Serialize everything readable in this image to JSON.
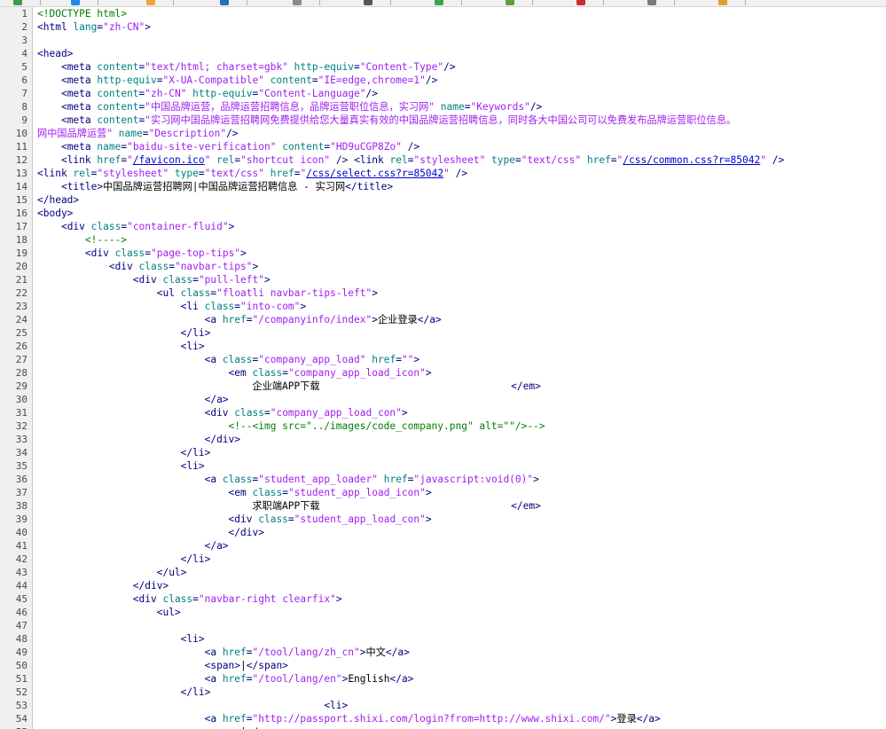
{
  "app": {
    "toolbar_icon_colors": [
      "#3b9c4a",
      "#1e88e5",
      "#f2a23b",
      "#2b6fb5",
      "#8a8a8a",
      "#555555",
      "#3aa655",
      "#5d9e38",
      "#c9302c",
      "#7a7a7a",
      "#e0a030"
    ]
  },
  "colors": {
    "tag": "#000080",
    "attribute": "#008080",
    "value": "#a020f0",
    "comment": "#008000",
    "link": "#0000cc",
    "gutter": "#f0f0f0"
  },
  "editor": {
    "lines": [
      [
        [
          "cmt",
          "<!DOCTYPE html>"
        ]
      ],
      [
        [
          "tag",
          "<html "
        ],
        [
          "att",
          "lang"
        ],
        [
          "tag",
          "="
        ],
        [
          "val",
          "\"zh-CN\""
        ],
        [
          "tag",
          ">"
        ]
      ],
      [],
      [
        [
          "tag",
          "<head>"
        ]
      ],
      [
        [
          "txt",
          "    "
        ],
        [
          "tag",
          "<meta "
        ],
        [
          "att",
          "content"
        ],
        [
          "tag",
          "="
        ],
        [
          "val",
          "\"text/html; charset=gbk\" "
        ],
        [
          "att",
          "http-equiv"
        ],
        [
          "tag",
          "="
        ],
        [
          "val",
          "\"Content-Type\""
        ],
        [
          "tag",
          "/>"
        ]
      ],
      [
        [
          "txt",
          "    "
        ],
        [
          "tag",
          "<meta "
        ],
        [
          "att",
          "http-equiv"
        ],
        [
          "tag",
          "="
        ],
        [
          "val",
          "\"X-UA-Compatible\" "
        ],
        [
          "att",
          "content"
        ],
        [
          "tag",
          "="
        ],
        [
          "val",
          "\"IE=edge,chrome=1\""
        ],
        [
          "tag",
          "/>"
        ]
      ],
      [
        [
          "txt",
          "    "
        ],
        [
          "tag",
          "<meta "
        ],
        [
          "att",
          "content"
        ],
        [
          "tag",
          "="
        ],
        [
          "val",
          "\"zh-CN\" "
        ],
        [
          "att",
          "http-equiv"
        ],
        [
          "tag",
          "="
        ],
        [
          "val",
          "\"Content-Language\""
        ],
        [
          "tag",
          "/>"
        ]
      ],
      [
        [
          "txt",
          "    "
        ],
        [
          "tag",
          "<meta "
        ],
        [
          "att",
          "content"
        ],
        [
          "tag",
          "="
        ],
        [
          "val",
          "\"中国品牌运营，品牌运营招聘信息，品牌运营职位信息，实习网\" "
        ],
        [
          "att",
          "name"
        ],
        [
          "tag",
          "="
        ],
        [
          "val",
          "\"Keywords\""
        ],
        [
          "tag",
          "/>"
        ]
      ],
      [
        [
          "txt",
          "    "
        ],
        [
          "tag",
          "<meta "
        ],
        [
          "att",
          "content"
        ],
        [
          "tag",
          "="
        ],
        [
          "val",
          "\"实习网中国品牌运营招聘网免费提供给您大量真实有效的中国品牌运营招聘信息，同时各大中国公司可以免费发布品牌运营职位信息。"
        ]
      ],
      [
        [
          "val",
          "网中国品牌运营\" "
        ],
        [
          "att",
          "name"
        ],
        [
          "tag",
          "="
        ],
        [
          "val",
          "\"Description\""
        ],
        [
          "tag",
          "/>"
        ]
      ],
      [
        [
          "txt",
          "    "
        ],
        [
          "tag",
          "<meta "
        ],
        [
          "att",
          "name"
        ],
        [
          "tag",
          "="
        ],
        [
          "val",
          "\"baidu-site-verification\" "
        ],
        [
          "att",
          "content"
        ],
        [
          "tag",
          "="
        ],
        [
          "val",
          "\"HD9uCGP8Zo\" "
        ],
        [
          "tag",
          "/>"
        ]
      ],
      [
        [
          "txt",
          "    "
        ],
        [
          "tag",
          "<link "
        ],
        [
          "att",
          "href"
        ],
        [
          "tag",
          "="
        ],
        [
          "val",
          "\""
        ],
        [
          "link",
          "/favicon.ico"
        ],
        [
          "val",
          "\" "
        ],
        [
          "att",
          "rel"
        ],
        [
          "tag",
          "="
        ],
        [
          "val",
          "\"shortcut icon\" "
        ],
        [
          "tag",
          "/> <link "
        ],
        [
          "att",
          "rel"
        ],
        [
          "tag",
          "="
        ],
        [
          "val",
          "\"stylesheet\" "
        ],
        [
          "att",
          "type"
        ],
        [
          "tag",
          "="
        ],
        [
          "val",
          "\"text/css\" "
        ],
        [
          "att",
          "href"
        ],
        [
          "tag",
          "="
        ],
        [
          "val",
          "\""
        ],
        [
          "link",
          "/css/common.css?r=85042"
        ],
        [
          "val",
          "\" "
        ],
        [
          "tag",
          "/>"
        ]
      ],
      [
        [
          "tag",
          "<link "
        ],
        [
          "att",
          "rel"
        ],
        [
          "tag",
          "="
        ],
        [
          "val",
          "\"stylesheet\" "
        ],
        [
          "att",
          "type"
        ],
        [
          "tag",
          "="
        ],
        [
          "val",
          "\"text/css\" "
        ],
        [
          "att",
          "href"
        ],
        [
          "tag",
          "="
        ],
        [
          "val",
          "\""
        ],
        [
          "link",
          "/css/select.css?r=85042"
        ],
        [
          "val",
          "\" "
        ],
        [
          "tag",
          "/>"
        ]
      ],
      [
        [
          "txt",
          "    "
        ],
        [
          "tag",
          "<title>"
        ],
        [
          "txt",
          "中国品牌运营招聘网|中国品牌运营招聘信息 - 实习网"
        ],
        [
          "tag",
          "</title>"
        ]
      ],
      [
        [
          "tag",
          "</head>"
        ]
      ],
      [
        [
          "tag",
          "<body>"
        ]
      ],
      [
        [
          "txt",
          "    "
        ],
        [
          "tag",
          "<div "
        ],
        [
          "att",
          "class"
        ],
        [
          "tag",
          "="
        ],
        [
          "val",
          "\"container-fluid\""
        ],
        [
          "tag",
          ">"
        ]
      ],
      [
        [
          "txt",
          "        "
        ],
        [
          "cmt",
          "<!---->"
        ]
      ],
      [
        [
          "txt",
          "        "
        ],
        [
          "tag",
          "<div "
        ],
        [
          "att",
          "class"
        ],
        [
          "tag",
          "="
        ],
        [
          "val",
          "\"page-top-tips\""
        ],
        [
          "tag",
          ">"
        ]
      ],
      [
        [
          "txt",
          "            "
        ],
        [
          "tag",
          "<div "
        ],
        [
          "att",
          "class"
        ],
        [
          "tag",
          "="
        ],
        [
          "val",
          "\"navbar-tips\""
        ],
        [
          "tag",
          ">"
        ]
      ],
      [
        [
          "txt",
          "                "
        ],
        [
          "tag",
          "<div "
        ],
        [
          "att",
          "class"
        ],
        [
          "tag",
          "="
        ],
        [
          "val",
          "\"pull-left\""
        ],
        [
          "tag",
          ">"
        ]
      ],
      [
        [
          "txt",
          "                    "
        ],
        [
          "tag",
          "<ul "
        ],
        [
          "att",
          "class"
        ],
        [
          "tag",
          "="
        ],
        [
          "val",
          "\"floatli navbar-tips-left\""
        ],
        [
          "tag",
          ">"
        ]
      ],
      [
        [
          "txt",
          "                        "
        ],
        [
          "tag",
          "<li "
        ],
        [
          "att",
          "class"
        ],
        [
          "tag",
          "="
        ],
        [
          "val",
          "\"into-com\""
        ],
        [
          "tag",
          ">"
        ]
      ],
      [
        [
          "txt",
          "                            "
        ],
        [
          "tag",
          "<a "
        ],
        [
          "att",
          "href"
        ],
        [
          "tag",
          "="
        ],
        [
          "val",
          "\"/companyinfo/index\""
        ],
        [
          "tag",
          ">"
        ],
        [
          "txt",
          "企业登录"
        ],
        [
          "tag",
          "</a>"
        ]
      ],
      [
        [
          "txt",
          "                        "
        ],
        [
          "tag",
          "</li>"
        ]
      ],
      [
        [
          "txt",
          "                        "
        ],
        [
          "tag",
          "<li>"
        ]
      ],
      [
        [
          "txt",
          "                            "
        ],
        [
          "tag",
          "<a "
        ],
        [
          "att",
          "class"
        ],
        [
          "tag",
          "="
        ],
        [
          "val",
          "\"company_app_load\" "
        ],
        [
          "att",
          "href"
        ],
        [
          "tag",
          "="
        ],
        [
          "val",
          "\"\""
        ],
        [
          "tag",
          ">"
        ]
      ],
      [
        [
          "txt",
          "                                "
        ],
        [
          "tag",
          "<em "
        ],
        [
          "att",
          "class"
        ],
        [
          "tag",
          "="
        ],
        [
          "val",
          "\"company_app_load_icon\""
        ],
        [
          "tag",
          ">"
        ]
      ],
      [
        [
          "txt",
          "                                    企业端APP下载                                "
        ],
        [
          "tag",
          "</em>"
        ]
      ],
      [
        [
          "txt",
          "                            "
        ],
        [
          "tag",
          "</a>"
        ]
      ],
      [
        [
          "txt",
          "                            "
        ],
        [
          "tag",
          "<div "
        ],
        [
          "att",
          "class"
        ],
        [
          "tag",
          "="
        ],
        [
          "val",
          "\"company_app_load_con\""
        ],
        [
          "tag",
          ">"
        ]
      ],
      [
        [
          "txt",
          "                                "
        ],
        [
          "cmt",
          "<!--<img src=\"../images/code_company.png\" alt=\"\"/>-->"
        ]
      ],
      [
        [
          "txt",
          "                            "
        ],
        [
          "tag",
          "</div>"
        ]
      ],
      [
        [
          "txt",
          "                        "
        ],
        [
          "tag",
          "</li>"
        ]
      ],
      [
        [
          "txt",
          "                        "
        ],
        [
          "tag",
          "<li>"
        ]
      ],
      [
        [
          "txt",
          "                            "
        ],
        [
          "tag",
          "<a "
        ],
        [
          "att",
          "class"
        ],
        [
          "tag",
          "="
        ],
        [
          "val",
          "\"student_app_loader\" "
        ],
        [
          "att",
          "href"
        ],
        [
          "tag",
          "="
        ],
        [
          "val",
          "\"javascript:void(0)\""
        ],
        [
          "tag",
          ">"
        ]
      ],
      [
        [
          "txt",
          "                                "
        ],
        [
          "tag",
          "<em "
        ],
        [
          "att",
          "class"
        ],
        [
          "tag",
          "="
        ],
        [
          "val",
          "\"student_app_load_icon\""
        ],
        [
          "tag",
          ">"
        ]
      ],
      [
        [
          "txt",
          "                                    求职端APP下载                                "
        ],
        [
          "tag",
          "</em>"
        ]
      ],
      [
        [
          "txt",
          "                                "
        ],
        [
          "tag",
          "<div "
        ],
        [
          "att",
          "class"
        ],
        [
          "tag",
          "="
        ],
        [
          "val",
          "\"student_app_load_con\""
        ],
        [
          "tag",
          ">"
        ]
      ],
      [
        [
          "txt",
          "                                "
        ],
        [
          "tag",
          "</div>"
        ]
      ],
      [
        [
          "txt",
          "                            "
        ],
        [
          "tag",
          "</a>"
        ]
      ],
      [
        [
          "txt",
          "                        "
        ],
        [
          "tag",
          "</li>"
        ]
      ],
      [
        [
          "txt",
          "                    "
        ],
        [
          "tag",
          "</ul>"
        ]
      ],
      [
        [
          "txt",
          "                "
        ],
        [
          "tag",
          "</div>"
        ]
      ],
      [
        [
          "txt",
          "                "
        ],
        [
          "tag",
          "<div "
        ],
        [
          "att",
          "class"
        ],
        [
          "tag",
          "="
        ],
        [
          "val",
          "\"navbar-right clearfix\""
        ],
        [
          "tag",
          ">"
        ]
      ],
      [
        [
          "txt",
          "                    "
        ],
        [
          "tag",
          "<ul>"
        ]
      ],
      [],
      [
        [
          "txt",
          "                        "
        ],
        [
          "tag",
          "<li>"
        ]
      ],
      [
        [
          "txt",
          "                            "
        ],
        [
          "tag",
          "<a "
        ],
        [
          "att",
          "href"
        ],
        [
          "tag",
          "="
        ],
        [
          "val",
          "\"/tool/lang/zh_cn\""
        ],
        [
          "tag",
          ">"
        ],
        [
          "txt",
          "中文"
        ],
        [
          "tag",
          "</a>"
        ]
      ],
      [
        [
          "txt",
          "                            "
        ],
        [
          "tag",
          "<span>"
        ],
        [
          "txt",
          "|"
        ],
        [
          "tag",
          "</span>"
        ]
      ],
      [
        [
          "txt",
          "                            "
        ],
        [
          "tag",
          "<a "
        ],
        [
          "att",
          "href"
        ],
        [
          "tag",
          "="
        ],
        [
          "val",
          "\"/tool/lang/en\""
        ],
        [
          "tag",
          ">"
        ],
        [
          "txt",
          "English"
        ],
        [
          "tag",
          "</a>"
        ]
      ],
      [
        [
          "txt",
          "                        "
        ],
        [
          "tag",
          "</li>"
        ]
      ],
      [
        [
          "txt",
          "                                                "
        ],
        [
          "tag",
          "<li>"
        ]
      ],
      [
        [
          "txt",
          "                            "
        ],
        [
          "tag",
          "<a "
        ],
        [
          "att",
          "href"
        ],
        [
          "tag",
          "="
        ],
        [
          "val",
          "\"http://passport.shixi.com/login?from=http://www.shixi.com/\""
        ],
        [
          "tag",
          ">"
        ],
        [
          "txt",
          "登录"
        ],
        [
          "tag",
          "</a>"
        ]
      ],
      [
        [
          "txt",
          "                            "
        ],
        [
          "tag",
          "<span>"
        ],
        [
          "txt",
          "|"
        ],
        [
          "tag",
          "</span>"
        ]
      ]
    ]
  }
}
